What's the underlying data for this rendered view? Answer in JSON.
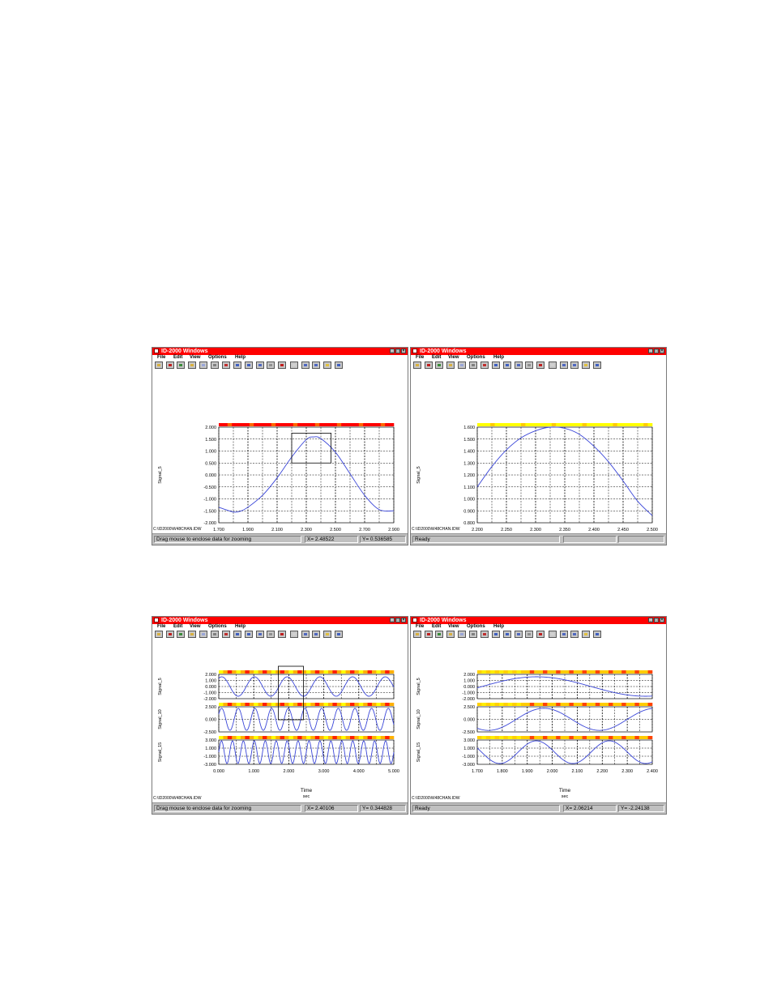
{
  "windows": [
    {
      "title": "ID-2000 Windows",
      "menu": [
        "File",
        "Edit",
        "View",
        "Options",
        "Help"
      ],
      "path": "C:\\ID2000\\W48CHAN.IDW",
      "status": {
        "message": "Drag mouse to enclose data for zooming",
        "x_readout": "X= 2.48522",
        "y_readout": "Y= 0.536585"
      }
    },
    {
      "title": "ID-2000 Windows",
      "menu": [
        "File",
        "Edit",
        "View",
        "Options",
        "Help"
      ],
      "path": "C:\\ID2000\\W48CHAN.IDW",
      "status": {
        "message": "Ready",
        "x_readout": "",
        "y_readout": ""
      }
    },
    {
      "title": "ID-2000 Windows",
      "menu": [
        "File",
        "Edit",
        "View",
        "Options",
        "Help"
      ],
      "path": "C:\\ID2000\\W48CHAN.IDW",
      "status": {
        "message": "Drag mouse to enclose data for zooming",
        "x_readout": "X= 2.40106",
        "y_readout": "Y= 0.344828"
      }
    },
    {
      "title": "ID-2000 Windows",
      "menu": [
        "File",
        "Edit",
        "View",
        "Options",
        "Help"
      ],
      "path": "C:\\ID2000\\W48CHAN.IDW",
      "status": {
        "message": "Ready",
        "x_readout": "X= 2.06214",
        "y_readout": "Y= -2.24138"
      }
    }
  ],
  "toolbar_icons": [
    "open-icon",
    "save-icon",
    "copy-icon",
    "print-icon",
    "print-setup-icon",
    "cut-icon",
    "chart-icon",
    "zoom-in-icon",
    "zoom-out-icon",
    "notes-icon",
    "list-icon",
    "mark-icon",
    "info-icon",
    "window-tile-icon",
    "window-cascade-icon",
    "help-icon",
    "context-help-icon"
  ],
  "colors": {
    "title_bar": "#ff0000",
    "signal_line": "#3a46d8",
    "grid": "#000000",
    "strip_red": "#ff0000",
    "strip_yellow": "#ffff00",
    "face": "#c0c0c0"
  },
  "chart_data": [
    {
      "type": "line",
      "window": 0,
      "xlabel": "Time",
      "xunit": "sec",
      "x_ticks": [
        "1.700",
        "1.900",
        "2.100",
        "2.300",
        "2.500",
        "2.700",
        "2.900"
      ],
      "xlim": [
        1.7,
        2.9
      ],
      "panels": [
        {
          "ylabel": "Signal_5",
          "ylim": [
            -2,
            2
          ],
          "y_ticks": [
            "2.000",
            "1.500",
            "1.000",
            "0.500",
            "0.000",
            "-0.500",
            "-1.000",
            "-1.500",
            "-2.000"
          ],
          "series": [
            {
              "x": [
                1.7,
                1.8,
                1.85,
                1.9,
                2.0,
                2.1,
                2.2,
                2.3,
                2.35,
                2.4,
                2.5,
                2.6,
                2.7,
                2.8,
                2.9
              ],
              "y": [
                -1.35,
                -1.55,
                -1.51,
                -1.35,
                -0.85,
                -0.12,
                0.75,
                1.48,
                1.59,
                1.52,
                0.95,
                0.05,
                -0.85,
                -1.45,
                -1.5
              ]
            }
          ],
          "strip": "red"
        }
      ],
      "zoom_box": {
        "x": [
          2.2,
          2.47
        ],
        "y": [
          0.5,
          1.75
        ]
      }
    },
    {
      "type": "line",
      "window": 1,
      "xlabel": "Time",
      "xunit": "sec",
      "x_ticks": [
        "2.200",
        "2.250",
        "2.300",
        "2.350",
        "2.400",
        "2.450",
        "2.500"
      ],
      "xlim": [
        2.2,
        2.5
      ],
      "panels": [
        {
          "ylabel": "Signal_5",
          "ylim": [
            0.8,
            1.6
          ],
          "y_ticks": [
            "1.600",
            "1.500",
            "1.400",
            "1.300",
            "1.200",
            "1.100",
            "1.000",
            "0.900",
            "0.800"
          ],
          "series": [
            {
              "x": [
                2.2,
                2.225,
                2.25,
                2.275,
                2.3,
                2.325,
                2.35,
                2.375,
                2.4,
                2.425,
                2.45,
                2.475,
                2.5
              ],
              "y": [
                1.1,
                1.27,
                1.41,
                1.51,
                1.57,
                1.6,
                1.59,
                1.54,
                1.44,
                1.31,
                1.15,
                0.98,
                0.86
              ]
            }
          ],
          "strip": "yellow"
        }
      ]
    },
    {
      "type": "line",
      "window": 2,
      "xlabel": "Time",
      "xunit": "sec",
      "x_ticks": [
        "0.000",
        "1.000",
        "2.000",
        "3.000",
        "4.000",
        "5.000"
      ],
      "xlim": [
        0,
        5
      ],
      "panels": [
        {
          "ylabel": "Signal_5",
          "ylim": [
            -2,
            2
          ],
          "y_ticks": [
            "2.000",
            "1.000",
            "0.000",
            "-1.000",
            "-2.000"
          ],
          "wave": {
            "freq": 1.07,
            "amp": 1.6,
            "phase": 1.0
          },
          "strip": "mixed"
        },
        {
          "ylabel": "Signal_10",
          "ylim": [
            -2.5,
            2.5
          ],
          "y_ticks": [
            "2.500",
            "0.000",
            "-2.500"
          ],
          "wave": {
            "freq": 2.1,
            "amp": 2.2,
            "phase": 0.5
          },
          "strip": "mixed"
        },
        {
          "ylabel": "Signal_15",
          "ylim": [
            -3,
            3
          ],
          "y_ticks": [
            "3.000",
            "1.000",
            "-1.000",
            "-3.000"
          ],
          "wave": {
            "freq": 3.2,
            "amp": 2.8,
            "phase": 0.0
          },
          "strip": "mixed"
        }
      ],
      "zoom_box": {
        "x": [
          1.7,
          2.42
        ]
      }
    },
    {
      "type": "line",
      "window": 3,
      "xlabel": "Time",
      "xunit": "sec",
      "x_ticks": [
        "1.700",
        "1.800",
        "1.900",
        "2.000",
        "2.100",
        "2.200",
        "2.300",
        "2.400"
      ],
      "xlim": [
        1.7,
        2.45
      ],
      "panels": [
        {
          "ylabel": "Signal_5",
          "ylim": [
            -2,
            2
          ],
          "y_ticks": [
            "2.000",
            "1.000",
            "0.000",
            "-1.000",
            "-2.000"
          ],
          "wave": {
            "freq": 1.07,
            "amp": 1.6,
            "phase": 1.0
          },
          "strip": "yellow-red"
        },
        {
          "ylabel": "Signal_10",
          "ylim": [
            -2.5,
            2.5
          ],
          "y_ticks": [
            "2.500",
            "0.000",
            "-2.500"
          ],
          "wave": {
            "freq": 2.1,
            "amp": 2.2,
            "phase": 0.5
          },
          "strip": "yellow-red"
        },
        {
          "ylabel": "Signal_15",
          "ylim": [
            -3,
            3
          ],
          "y_ticks": [
            "3.000",
            "1.000",
            "-1.000",
            "-3.000"
          ],
          "wave": {
            "freq": 3.2,
            "amp": 2.8,
            "phase": 0.0
          },
          "strip": "yellow-red"
        }
      ]
    }
  ]
}
